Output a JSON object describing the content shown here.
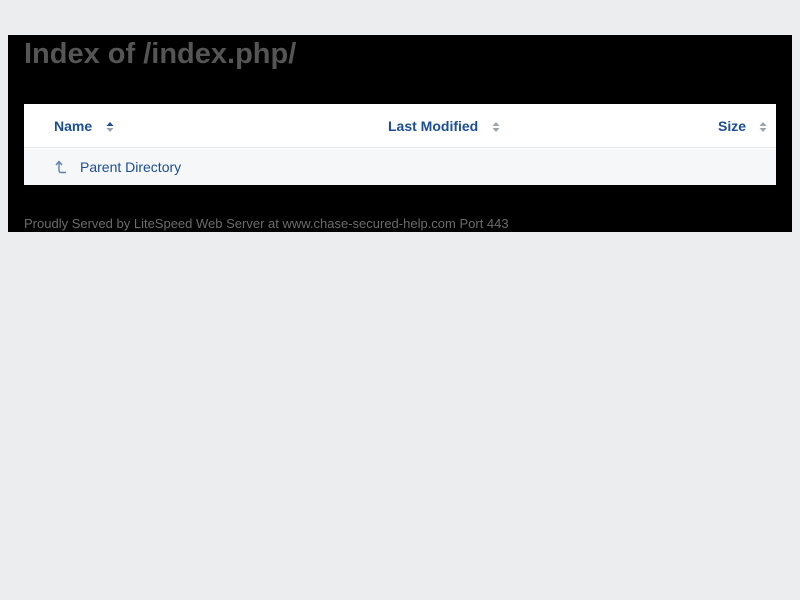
{
  "page": {
    "title": "Index of /index.php/"
  },
  "table": {
    "columns": [
      {
        "label": "Name",
        "sort_icon": "sort-icon"
      },
      {
        "label": "Last Modified",
        "sort_icon": "sort-icon"
      },
      {
        "label": "Size",
        "sort_icon": "sort-icon"
      }
    ],
    "rows": [
      {
        "name": "Parent Directory",
        "icon": "parent-directory-icon",
        "last_modified": "",
        "size": ""
      }
    ]
  },
  "footer": {
    "text": "Proudly Served by LiteSpeed Web Server at www.chase-secured-help.com Port 443"
  },
  "colors": {
    "background": "#ecedef",
    "panel": "#000000",
    "link": "#1a4d9c",
    "title": "#555555"
  }
}
